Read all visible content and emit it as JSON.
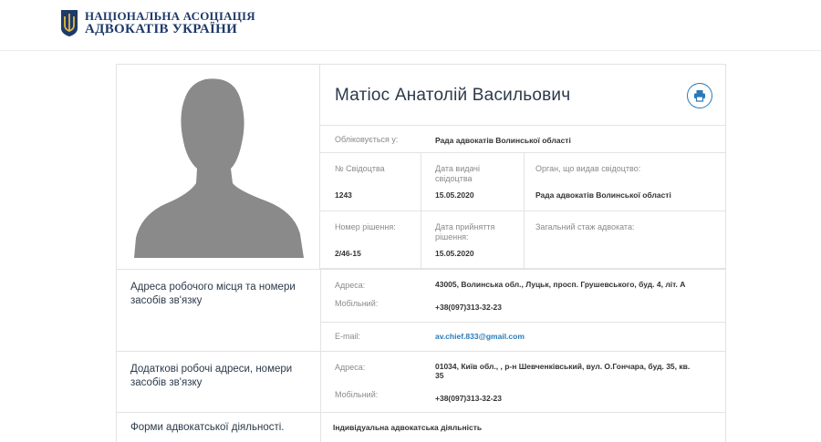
{
  "header": {
    "logo_line1": "НАЦІОНАЛЬНА АСОЦІАЦІЯ",
    "logo_line2": "АДВОКАТІВ УКРАЇНИ"
  },
  "profile": {
    "name": "Матіос Анатолій Васильович",
    "print_icon": "printer-icon",
    "registered_label": "Обліковується у:",
    "registered_value": "Рада адвокатів Волинської області",
    "cert_no_label": "№ Свідоцтва",
    "cert_no_value": "1243",
    "cert_date_label": "Дата видачі свідоцтва",
    "cert_date_value": "15.05.2020",
    "issuer_label": "Орган, що видав свідоцтво:",
    "issuer_value": "Рада адвокатів Волинської області",
    "decision_no_label": "Номер рішення:",
    "decision_no_value": "2/46-15",
    "decision_date_label": "Дата прийняття рішення:",
    "decision_date_value": "15.05.2020",
    "experience_label": "Загальний стаж адвоката:"
  },
  "workplace": {
    "title": "Адреса робочого місця та номери засобів зв'язку",
    "address_label": "Адреса:",
    "address_value": "43005, Волинська обл., Луцьк, просп. Грушевського, буд. 4, літ. А",
    "mobile_label": "Мобільний:",
    "mobile_value": "+38(097)313-32-23",
    "email_label": "E-mail:",
    "email_value": "av.chief.833@gmail.com"
  },
  "additional": {
    "title": "Додаткові робочі адреси, номери засобів зв'язку",
    "address_label": "Адреса:",
    "address_value": "01034, Київ обл., , р-н Шевченківський, вул. О.Гончара, буд. 35, кв. 35",
    "mobile_label": "Мобільний:",
    "mobile_value": "+38(097)313-32-23"
  },
  "forms": {
    "title": "Форми адвокатської діяльності.",
    "value": "Індивідуальна адвокатська діяльність"
  },
  "colors": {
    "brand": "#1d3a6a",
    "accent": "#2a7ab8",
    "border": "#e3e3e3"
  }
}
